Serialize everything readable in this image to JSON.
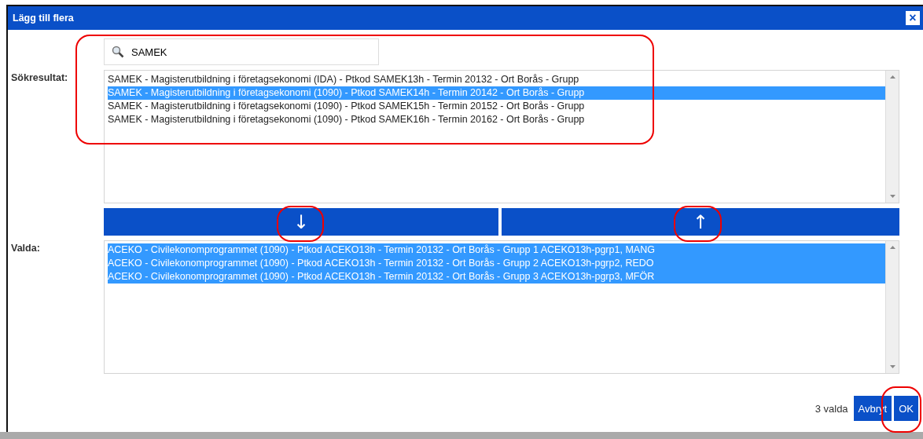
{
  "dialog": {
    "title": "Lägg till flera",
    "close": "×"
  },
  "search": {
    "value": "SAMEK"
  },
  "results": {
    "label": "Sökresultat:",
    "items": [
      {
        "text": "SAMEK - Magisterutbildning i företagsekonomi (IDA) - Ptkod SAMEK13h - Termin 20132 - Ort Borås - Grupp",
        "selected": false
      },
      {
        "text": "SAMEK - Magisterutbildning i företagsekonomi (1090) - Ptkod SAMEK14h - Termin 20142 - Ort Borås - Grupp",
        "selected": true
      },
      {
        "text": "SAMEK - Magisterutbildning i företagsekonomi (1090) - Ptkod SAMEK15h - Termin 20152 - Ort Borås - Grupp",
        "selected": false
      },
      {
        "text": "SAMEK - Magisterutbildning i företagsekonomi (1090) - Ptkod SAMEK16h - Termin 20162 - Ort Borås - Grupp",
        "selected": false
      }
    ]
  },
  "move_buttons": [
    {
      "symbol": "↓"
    },
    {
      "symbol": "↑"
    }
  ],
  "chosen": {
    "label": "Valda:",
    "items": [
      {
        "text": "ACEKO - Civilekonomprogrammet (1090) - Ptkod ACEKO13h - Termin 20132 - Ort Borås - Grupp 1 ACEKO13h-pgrp1, MANG",
        "selected": true
      },
      {
        "text": "ACEKO - Civilekonomprogrammet (1090) - Ptkod ACEKO13h - Termin 20132 - Ort Borås - Grupp 2 ACEKO13h-pgrp2, REDO",
        "selected": true
      },
      {
        "text": "ACEKO - Civilekonomprogrammet (1090) - Ptkod ACEKO13h - Termin 20132 - Ort Borås - Grupp 3 ACEKO13h-pgrp3, MFÖR",
        "selected": true
      }
    ]
  },
  "footer": {
    "count": "3 valda",
    "buttons": [
      "Avbryt",
      "OK"
    ]
  }
}
